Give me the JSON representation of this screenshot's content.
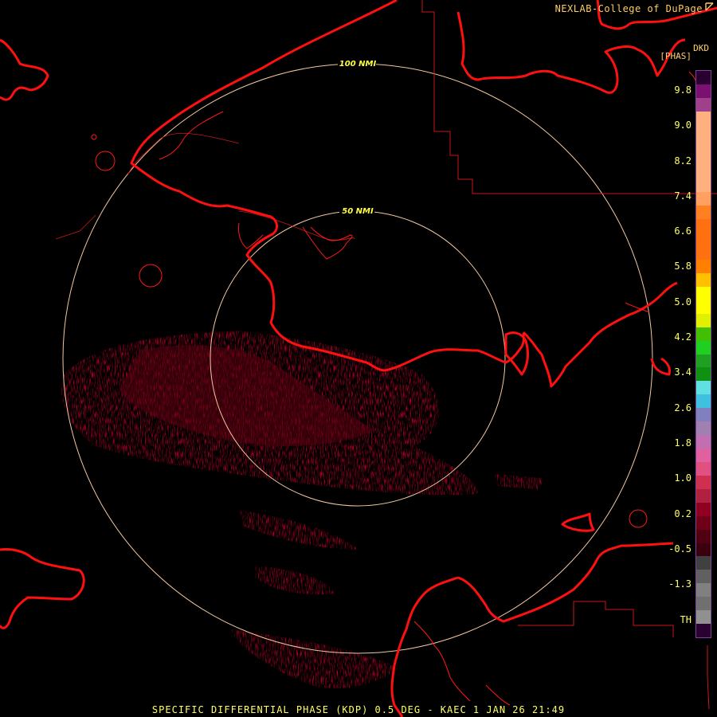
{
  "header": {
    "credit": "NEXLAB-College of DuPage"
  },
  "legend": {
    "product_code": "DKD",
    "units": "[PHAS]",
    "ticks": [
      "9.8",
      "9.0",
      "8.2",
      "7.4",
      "6.6",
      "5.8",
      "5.0",
      "4.2",
      "3.4",
      "2.6",
      "1.8",
      "1.0",
      "0.2",
      "-0.5",
      "-1.3",
      "TH"
    ],
    "colors": [
      "#2a0030",
      "#7a1070",
      "#a0408a",
      "#ffb080",
      "#ffb080",
      "#ffb080",
      "#ffb080",
      "#ffb080",
      "#ffb080",
      "#ffa060",
      "#ff8020",
      "#ff7010",
      "#ff7010",
      "#ff7010",
      "#ff8000",
      "#ffc000",
      "#ffff00",
      "#ffff00",
      "#e0f000",
      "#40c000",
      "#20d020",
      "#20a020",
      "#109010",
      "#60e0e0",
      "#40c0e0",
      "#8080c0",
      "#a080b0",
      "#c070b0",
      "#e060a0",
      "#e05080",
      "#d03050",
      "#b02040",
      "#900020",
      "#700018",
      "#500010",
      "#3a0010",
      "#404040",
      "#606060",
      "#808080",
      "#707070",
      "#909090",
      "#2a0030"
    ]
  },
  "map": {
    "range_rings": [
      {
        "label": "50 NMI"
      },
      {
        "label": "100 NMI"
      }
    ]
  },
  "footer": {
    "caption": "SPECIFIC DIFFERENTIAL PHASE (KDP) 0.5 DEG - KAEC 1 JAN 26 21:49"
  }
}
